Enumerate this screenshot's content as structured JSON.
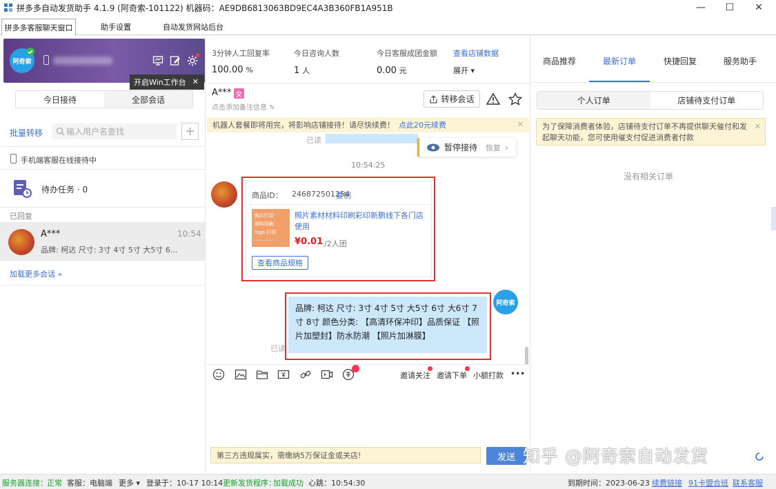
{
  "window": {
    "title": "拼多多自动发货助手 4.1.9 (阿奇索-101122) 机器码：AE9DB6813063BD9EC4A3B360FB1A951B",
    "minimize": "—",
    "maximize": "☐",
    "close": "✕"
  },
  "tabs": [
    "拼多多客服聊天窗口",
    "助手设置",
    "自动发货网站后台"
  ],
  "profile": {
    "logo_text": "阿奇索",
    "tooltip": "开启Win工作台",
    "tooltip_close": "✕"
  },
  "left": {
    "seg_today": "今日接待",
    "seg_all": "全部会话",
    "batch_transfer": "批量转移",
    "search_placeholder": "输入用户名查找",
    "plus": "+",
    "mobile_status": "手机端客服在线接待中",
    "todo": "待办任务 · 0",
    "replied_header": "已回复",
    "conv_name": "A***",
    "conv_time": "10:54",
    "conv_preview": "品牌: 柯达 尺寸: 3寸 4寸 5寸 大5寸 6...",
    "load_more": "加载更多会话 »"
  },
  "stats": [
    {
      "label": "3分钟人工回复率",
      "value": "100.00",
      "unit": "%"
    },
    {
      "label": "今日咨询人数",
      "value": "1",
      "unit": "人"
    },
    {
      "label": "今日客服成团金额",
      "value": "0.00",
      "unit": "元"
    }
  ],
  "stats_link": "查看店铺数据",
  "stats_expand": "展开",
  "chat": {
    "customer": "A***",
    "gender_badge": "女",
    "remark": "点击添加备注信息",
    "transfer_btn": "转移会话",
    "notice": "机器人套餐即将用完，将影响店铺接待！请尽快续费！",
    "notice_link": "点此20元续费",
    "notice_close": "✕",
    "read_label": "已读",
    "pause_label": "暂停接待",
    "resume_label": "恢复",
    "timestamp": "10:54:25",
    "product_id_label": "商品ID：",
    "product_id": "246872501254",
    "copy": "复制",
    "thumb_lines": [
      "照片打印",
      "货料印刷",
      "logo 打印",
      "············"
    ],
    "product_title": "照片素材材料印刷彩印新鹏线下各门店使用",
    "price": "¥0.01",
    "group_label": "/2人团",
    "spec_btn": "查看商品规格",
    "agent_avatar": "阿奇索",
    "bubble_text": "品牌: 柯达 尺寸: 3寸 4寸 5寸 大5寸 6寸 大6寸 7寸 8寸 颜色分类: 【高清环保冲印】品质保证 【照片加塑封】防水防潮 【照片加淋膜】",
    "read_label_2": "已读",
    "tool_invite_follow": "邀请关注",
    "tool_invite_order": "邀请下单",
    "tool_small_pay": "小额打款",
    "tool_more": "•••",
    "input_warning": "第三方违规属实，需缴纳5万保证金或关店!",
    "send": "发送"
  },
  "right": {
    "tabs": [
      "商品推荐",
      "最新订单",
      "快捷回复",
      "服务助手"
    ],
    "seg_personal": "个人订单",
    "seg_pending": "店铺待支付订单",
    "notice": "为了保障消费者体验，店铺待支付订单不再提供聊天催付和发起聊天功能，您可使用催支付促进消费者付款",
    "notice_close": "✕",
    "empty": "没有相关订单"
  },
  "status": {
    "server_label": "服务器连接：",
    "server_state": "正常",
    "client": "客服：电脑端",
    "more": "更多 ▾",
    "login": "登录于：10-17 10:14",
    "update_label": "更新发货程序：",
    "update_state": "加载成功",
    "heartbeat": "心跳：10:54:30",
    "expire": "到期时间：2023-06-23",
    "renew": "续费链接",
    "link91": "91卡盟合班",
    "contact": "联系客服"
  },
  "watermark": "知乎 @阿奇索自动发货",
  "colors": {
    "accent": "#3d6fd8",
    "highlight": "#e03030",
    "bubble": "#cde7fb",
    "notice": "#fdf4d6"
  }
}
